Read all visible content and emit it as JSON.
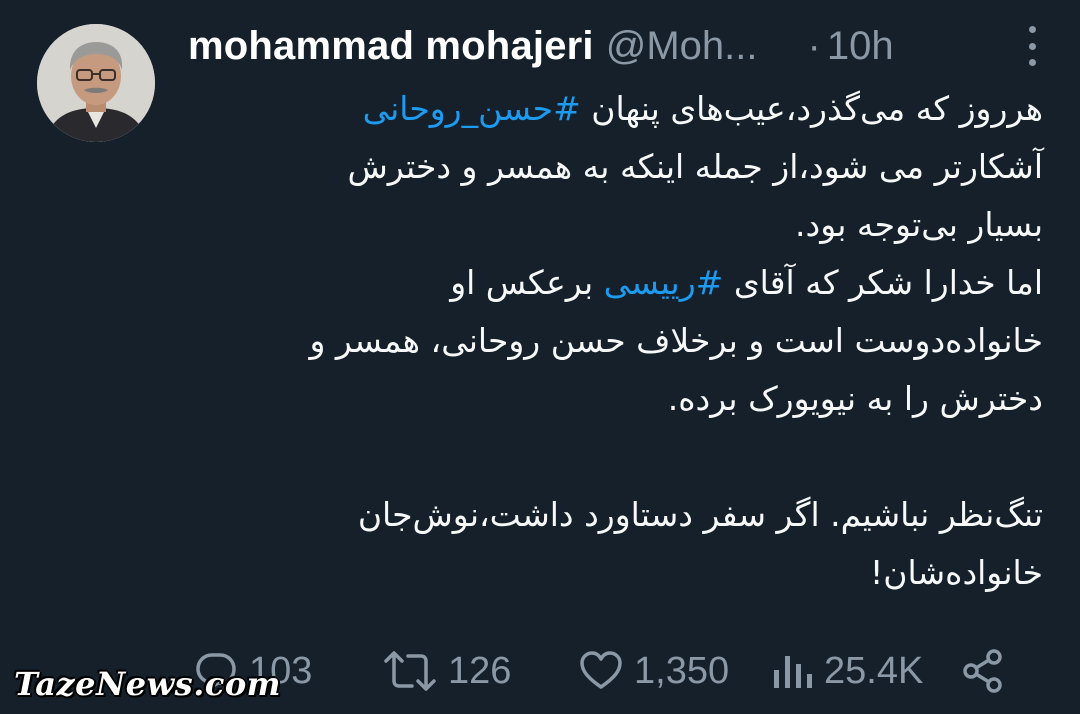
{
  "tweet": {
    "display_name": "mohammad mohajeri",
    "handle": "@Moh...",
    "separator": "·",
    "time": "10h",
    "avatar_icon": "user-avatar-photo",
    "more_icon": "more-options-icon",
    "lines": [
      {
        "pre": "هرروز که می‌گذرد،عیب‌های پنهان ",
        "tag": "#حسن_روحانی",
        "post": ""
      },
      {
        "pre": "آشکارتر می شود،از جمله اینکه به همسر و دخترش",
        "tag": "",
        "post": ""
      },
      {
        "pre": "بسیار بی‌توجه بود.",
        "tag": "",
        "post": ""
      },
      {
        "pre": "اما خدارا شکر که آقای ",
        "tag": "#رییسی",
        "post": "  برعکس او"
      },
      {
        "pre": "خانواده‌دوست است و برخلاف حسن روحانی، همسر و",
        "tag": "",
        "post": ""
      },
      {
        "pre": "دخترش را به نیویورک برده.",
        "tag": "",
        "post": ""
      },
      {
        "pre": "تنگ‌نظر نباشیم. اگر سفر دستاورد داشت،نوش‌جان",
        "tag": "",
        "post": ""
      },
      {
        "pre": "خانواده‌شان!",
        "tag": "",
        "post": ""
      }
    ],
    "hashtag_color": "#1d9bf0"
  },
  "actions": {
    "reply": {
      "icon": "reply-icon",
      "count": "103"
    },
    "retweet": {
      "icon": "retweet-icon",
      "count": "126"
    },
    "like": {
      "icon": "heart-icon",
      "count": "1,350"
    },
    "views": {
      "icon": "views-icon",
      "count": "25.4K"
    },
    "share": {
      "icon": "share-icon"
    }
  },
  "watermark": "TazeNews.com",
  "colors": {
    "background": "#15202b",
    "text": "#f7f9f9",
    "secondary": "#8b98a5",
    "accent": "#1d9bf0"
  }
}
